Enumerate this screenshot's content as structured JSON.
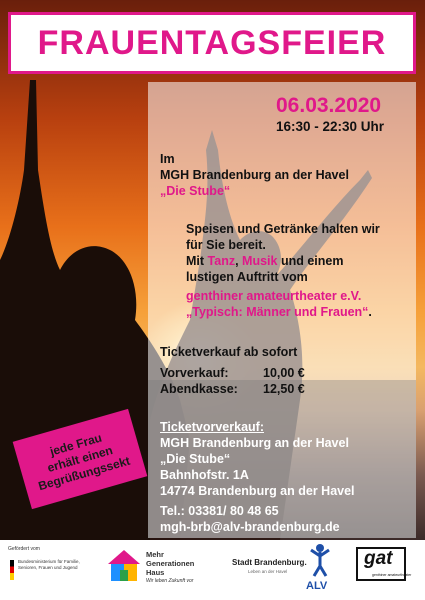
{
  "title": "FRAUENTAGSFEIER",
  "date": "06.03.2020",
  "time": "16:30 - 22:30 Uhr",
  "venue": {
    "im": "Im",
    "name": "MGH Brandenburg an der Havel",
    "stube": "„Die Stube“"
  },
  "description": {
    "line1": "Speisen und Getränke halten wir",
    "line2": "für Sie bereit.",
    "line3_pre": "Mit ",
    "tanz": "Tanz",
    "comma": ", ",
    "musik": "Musik",
    "line3_post": " und einem",
    "line4": "lustigen Auftritt vom",
    "theater": "genthiner  amateurtheater  e.V.",
    "play": "„Typisch: Männer und Frauen“",
    "dot": "."
  },
  "tickets": {
    "heading": "Ticketverkauf ab sofort",
    "vorverkauf_label": "Vorverkauf:",
    "vorverkauf_price": "10,00 €",
    "abendkasse_label": "Abendkasse:",
    "abendkasse_price": "12,50 €"
  },
  "badge": {
    "line1": "jede Frau",
    "line2": "erhält einen",
    "line3": "Begrüßungssekt"
  },
  "contact": {
    "heading": "Ticketvorverkauf:",
    "line1": "MGH Brandenburg an der Havel",
    "line2": "„Die Stube“",
    "line3": "Bahnhofstr. 1A",
    "line4": "14774 Brandenburg an der Havel",
    "phone": "Tel.: 03381/ 80 48 65",
    "email": "mgh-brb@alv-brandenburg.de"
  },
  "footer": {
    "ministry_pre": "Gefördert vom",
    "ministry": "Bundesministerium für Familie, Senioren, Frauen und Jugend",
    "mgh_line1": "Mehr",
    "mgh_line2": "Generationen",
    "mgh_line3": "Haus",
    "mgh_slogan": "Wir leben Zukunft vor",
    "city": "Stadt Brandenburg.",
    "city_slogan": "Leben an der Havel",
    "alv": "ALV",
    "gat": "gat",
    "gat_sub": "genthiner amateurtheater"
  },
  "colors": {
    "accent": "#e0188a"
  }
}
